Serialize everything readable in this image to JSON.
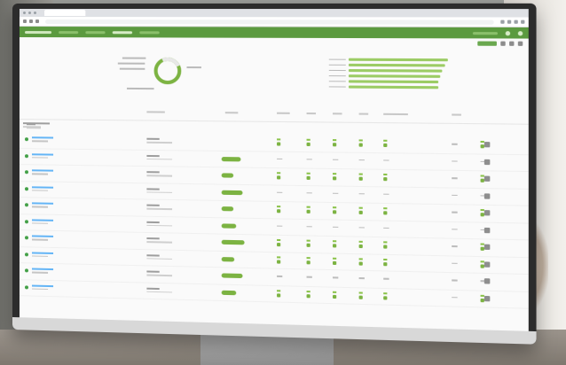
{
  "scene": {
    "description_free": true
  },
  "browser": {
    "tabs": [
      "tab"
    ],
    "has_address_bar": true
  },
  "app": {
    "nav_items": [
      "nav",
      "nav",
      "nav",
      "nav"
    ],
    "active_nav_index": 2,
    "accent": "#5b9a3f"
  },
  "summary": {
    "donut_fill_fraction": 0.85,
    "bars": [
      0.95,
      0.93,
      0.9,
      0.88,
      0.86,
      0.86
    ]
  },
  "table": {
    "columns": 9,
    "rows": [
      {
        "pill": 0.0,
        "status": [
          1,
          1,
          1,
          1,
          1,
          0,
          1
        ]
      },
      {
        "pill": 0.8,
        "status": [
          0,
          0,
          0,
          0,
          0,
          0,
          0
        ]
      },
      {
        "pill": 0.5,
        "status": [
          1,
          1,
          1,
          1,
          1,
          0,
          1
        ]
      },
      {
        "pill": 0.9,
        "status": [
          0,
          0,
          0,
          0,
          0,
          0,
          0
        ]
      },
      {
        "pill": 0.5,
        "status": [
          1,
          1,
          1,
          1,
          1,
          0,
          1
        ]
      },
      {
        "pill": 0.6,
        "status": [
          0,
          0,
          0,
          0,
          0,
          0,
          0
        ]
      },
      {
        "pill": 0.95,
        "status": [
          1,
          1,
          1,
          1,
          1,
          0,
          1
        ]
      },
      {
        "pill": 0.55,
        "status": [
          1,
          1,
          1,
          1,
          1,
          0,
          1
        ]
      },
      {
        "pill": 0.9,
        "status": [
          0,
          0,
          0,
          0,
          0,
          0,
          0
        ]
      },
      {
        "pill": 0.6,
        "status": [
          1,
          1,
          1,
          1,
          1,
          0,
          1
        ]
      }
    ]
  }
}
